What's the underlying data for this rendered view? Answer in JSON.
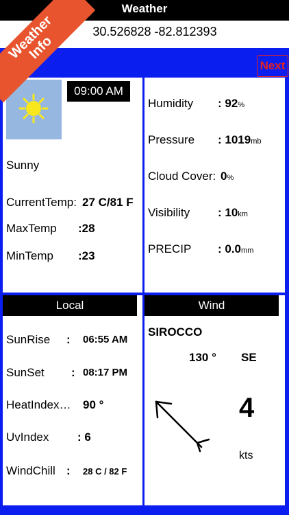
{
  "header": {
    "title": "Weather",
    "coordinates": "30.526828 -82.812393",
    "next_label": "Next"
  },
  "ribbon": {
    "line1": "Weather",
    "line2": "Info"
  },
  "current": {
    "time": "09:00 AM",
    "condition": "Sunny",
    "current_temp_label": "CurrentTemp:",
    "current_temp_value": "27 C/81 F",
    "max_temp_label": "MaxTemp",
    "max_temp_value": ":28",
    "min_temp_label": "MinTemp",
    "min_temp_value": ":23",
    "icon": "sun-icon"
  },
  "details": {
    "humidity_label": "Humidity",
    "humidity_value": ": 92",
    "humidity_unit": "%",
    "pressure_label": "Pressure",
    "pressure_value": ": 1019",
    "pressure_unit": "mb",
    "cloud_label": "Cloud Cover:",
    "cloud_value": " 0",
    "cloud_unit": "%",
    "visibility_label": "Visibility",
    "visibility_value": ": 10",
    "visibility_unit": "km",
    "precip_label": "PRECIP",
    "precip_value": ": 0.0",
    "precip_unit": "mm"
  },
  "local": {
    "title": "Local",
    "sunrise_label": "SunRise",
    "sunrise_colon": ":",
    "sunrise_value": "06:55 AM",
    "sunset_label": "SunSet",
    "sunset_colon": ":",
    "sunset_value": "08:17 PM",
    "heatindex_label": "HeatIndex…",
    "heatindex_value": "90 °",
    "uvindex_label": "UvIndex",
    "uvindex_value": ": 6",
    "windchill_label": "WindChill",
    "windchill_colon": ":",
    "windchill_value": "28 C / 82 F"
  },
  "wind": {
    "title": "Wind",
    "name": "SIROCCO",
    "direction_degrees": "130 °",
    "direction_cardinal": "SE",
    "speed": "4",
    "speed_unit": "kts",
    "arrow_icon": "wind-direction-arrow-icon"
  },
  "colors": {
    "frame": "#0b1ef0",
    "accent": "#e52121",
    "ribbon": "#e8542e",
    "sun": "#f8e71c",
    "sky": "#96b8e0"
  }
}
